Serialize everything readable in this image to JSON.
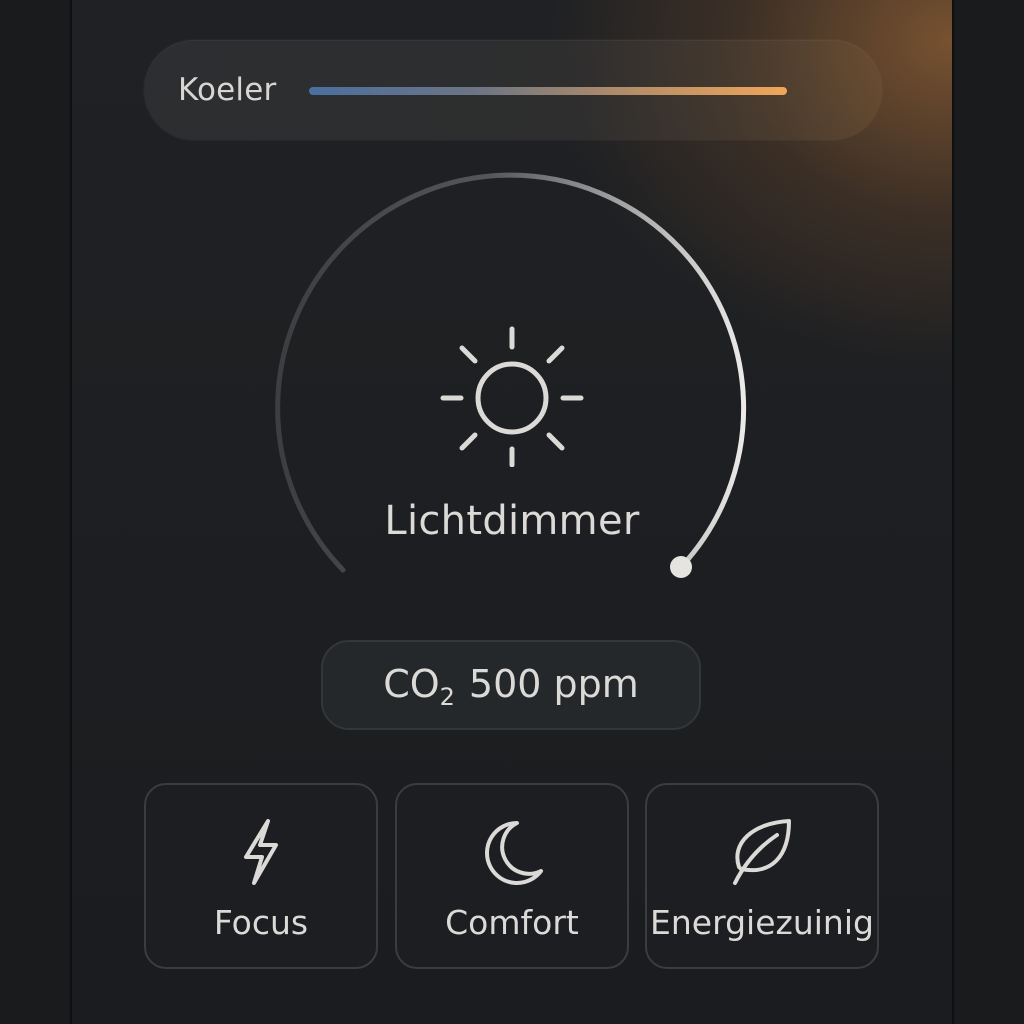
{
  "slider": {
    "label": "Koeler",
    "track_colors": [
      "#4a6fa0",
      "#f0a65a"
    ]
  },
  "dial": {
    "label": "Lichtdimmer",
    "icon": "sun-icon"
  },
  "co2": {
    "prefix": "CO",
    "subscript": "2",
    "value": "500 ppm"
  },
  "modes": [
    {
      "label": "Focus",
      "icon": "lightning-icon"
    },
    {
      "label": "Comfort",
      "icon": "moon-icon"
    },
    {
      "label": "Energiezuinig",
      "icon": "leaf-icon"
    }
  ]
}
